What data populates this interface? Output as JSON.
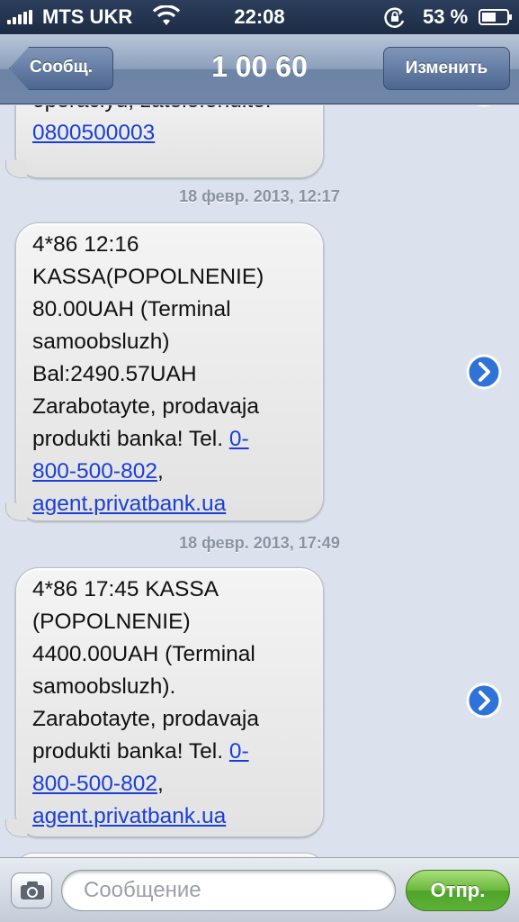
{
  "status_bar": {
    "carrier": "MTS UKR",
    "time": "22:08",
    "battery_percent": "53 %",
    "icons": [
      "signal-icon",
      "wifi-icon",
      "rotation-lock-icon",
      "battery-icon"
    ]
  },
  "nav": {
    "back_label": "Сообщ.",
    "title": "1 00 60",
    "edit_label": "Изменить"
  },
  "messages": [
    {
      "lines": [
        "operaciyu, zatelefonuite:"
      ],
      "links": [
        "0800500003"
      ]
    },
    {
      "timestamp": "18 февр. 2013, 12:17",
      "lines": [
        "4*86 12:16",
        "KASSA(POPOLNENIE)",
        "80.00UAH (Terminal",
        "samoobsluzh)",
        "Bal:2490.57UAH",
        "Zarabotayte, prodavaja",
        "produkti banka! Tel. "
      ],
      "phone_link_part1": "0-",
      "phone_link_part2": "800-500-802",
      "after_phone": ",",
      "site_link": "agent.privatbank.ua"
    },
    {
      "timestamp": "18 февр. 2013, 17:49",
      "lines": [
        "4*86 17:45 KASSA",
        "(POPOLNENIE)",
        "4400.00UAH (Terminal",
        "samoobsluzh).",
        "Zarabotayte, prodavaja",
        "produkti banka! Tel. "
      ],
      "phone_link_part1": "0-",
      "phone_link_part2": "800-500-802",
      "after_phone": ",",
      "site_link": "agent.privatbank.ua"
    }
  ],
  "compose": {
    "placeholder": "Сообщение",
    "send_label": "Отпр."
  },
  "colors": {
    "link": "#1a3fd8",
    "send_button": "#5cb236",
    "nav_bar": "#6f86a8"
  }
}
